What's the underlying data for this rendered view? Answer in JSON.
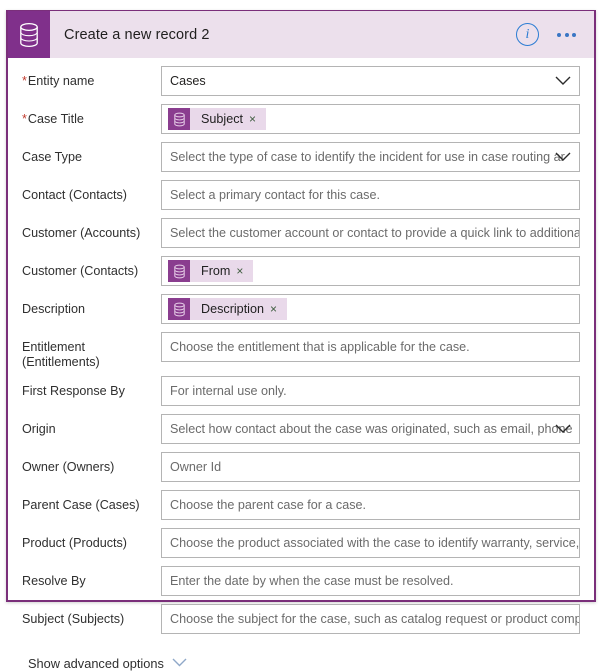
{
  "header": {
    "icon": "database-icon",
    "title": "Create a new record 2",
    "info_icon": "info-icon",
    "info_label": "i",
    "more_icon": "ellipsis-icon"
  },
  "colors": {
    "brand_purple": "#80308b",
    "card_border": "#7a2f7a",
    "header_bg": "#ece0ec",
    "token_bg": "#e9d9ea",
    "token_icon_bg": "#8a3d8f",
    "required_star": "#c0392b",
    "info_blue": "#2b7cd3",
    "placeholder_text": "#6b6b6b"
  },
  "fields": [
    {
      "label": "Entity name",
      "required": true,
      "type": "dropdown",
      "value": "Cases",
      "is_placeholder": false,
      "chevron": true
    },
    {
      "label": "Case Title",
      "required": true,
      "type": "token",
      "token": {
        "label": "Subject",
        "icon": "database-icon",
        "close": "×"
      },
      "chevron": false
    },
    {
      "label": "Case Type",
      "required": false,
      "type": "dropdown",
      "value": "Select the type of case to identify the incident for use in case routing ar",
      "is_placeholder": true,
      "chevron": true
    },
    {
      "label": "Contact (Contacts)",
      "required": false,
      "type": "text",
      "value": "Select a primary contact for this case.",
      "is_placeholder": true,
      "chevron": false
    },
    {
      "label": "Customer (Accounts)",
      "required": false,
      "type": "text",
      "value": "Select the customer account or contact to provide a quick link to additional cu",
      "is_placeholder": true,
      "chevron": false
    },
    {
      "label": "Customer (Contacts)",
      "required": false,
      "type": "token",
      "token": {
        "label": "From",
        "icon": "database-icon",
        "close": "×"
      },
      "chevron": false
    },
    {
      "label": "Description",
      "required": false,
      "type": "token",
      "token": {
        "label": "Description",
        "icon": "database-icon",
        "close": "×"
      },
      "chevron": false
    },
    {
      "label": "Entitlement (Entitlements)",
      "required": false,
      "type": "text",
      "value": "Choose the entitlement that is applicable for the case.",
      "is_placeholder": true,
      "chevron": false
    },
    {
      "label": "First Response By",
      "required": false,
      "type": "text",
      "value": "For internal use only.",
      "is_placeholder": true,
      "chevron": false
    },
    {
      "label": "Origin",
      "required": false,
      "type": "dropdown",
      "value": "Select how contact about the case was originated, such as email, phone",
      "is_placeholder": true,
      "chevron": true
    },
    {
      "label": "Owner (Owners)",
      "required": false,
      "type": "text",
      "value": "Owner Id",
      "is_placeholder": true,
      "chevron": false
    },
    {
      "label": "Parent Case (Cases)",
      "required": false,
      "type": "text",
      "value": "Choose the parent case for a case.",
      "is_placeholder": true,
      "chevron": false
    },
    {
      "label": "Product (Products)",
      "required": false,
      "type": "text",
      "value": "Choose the product associated with the case to identify warranty, service, or c",
      "is_placeholder": true,
      "chevron": false
    },
    {
      "label": "Resolve By",
      "required": false,
      "type": "text",
      "value": "Enter the date by when the case must be resolved.",
      "is_placeholder": true,
      "chevron": false
    },
    {
      "label": "Subject (Subjects)",
      "required": false,
      "type": "text",
      "value": "Choose the subject for the case, such as catalog request or product complaint",
      "is_placeholder": true,
      "chevron": false
    }
  ],
  "advanced": {
    "label": "Show advanced options",
    "icon": "chevron-down-icon"
  }
}
